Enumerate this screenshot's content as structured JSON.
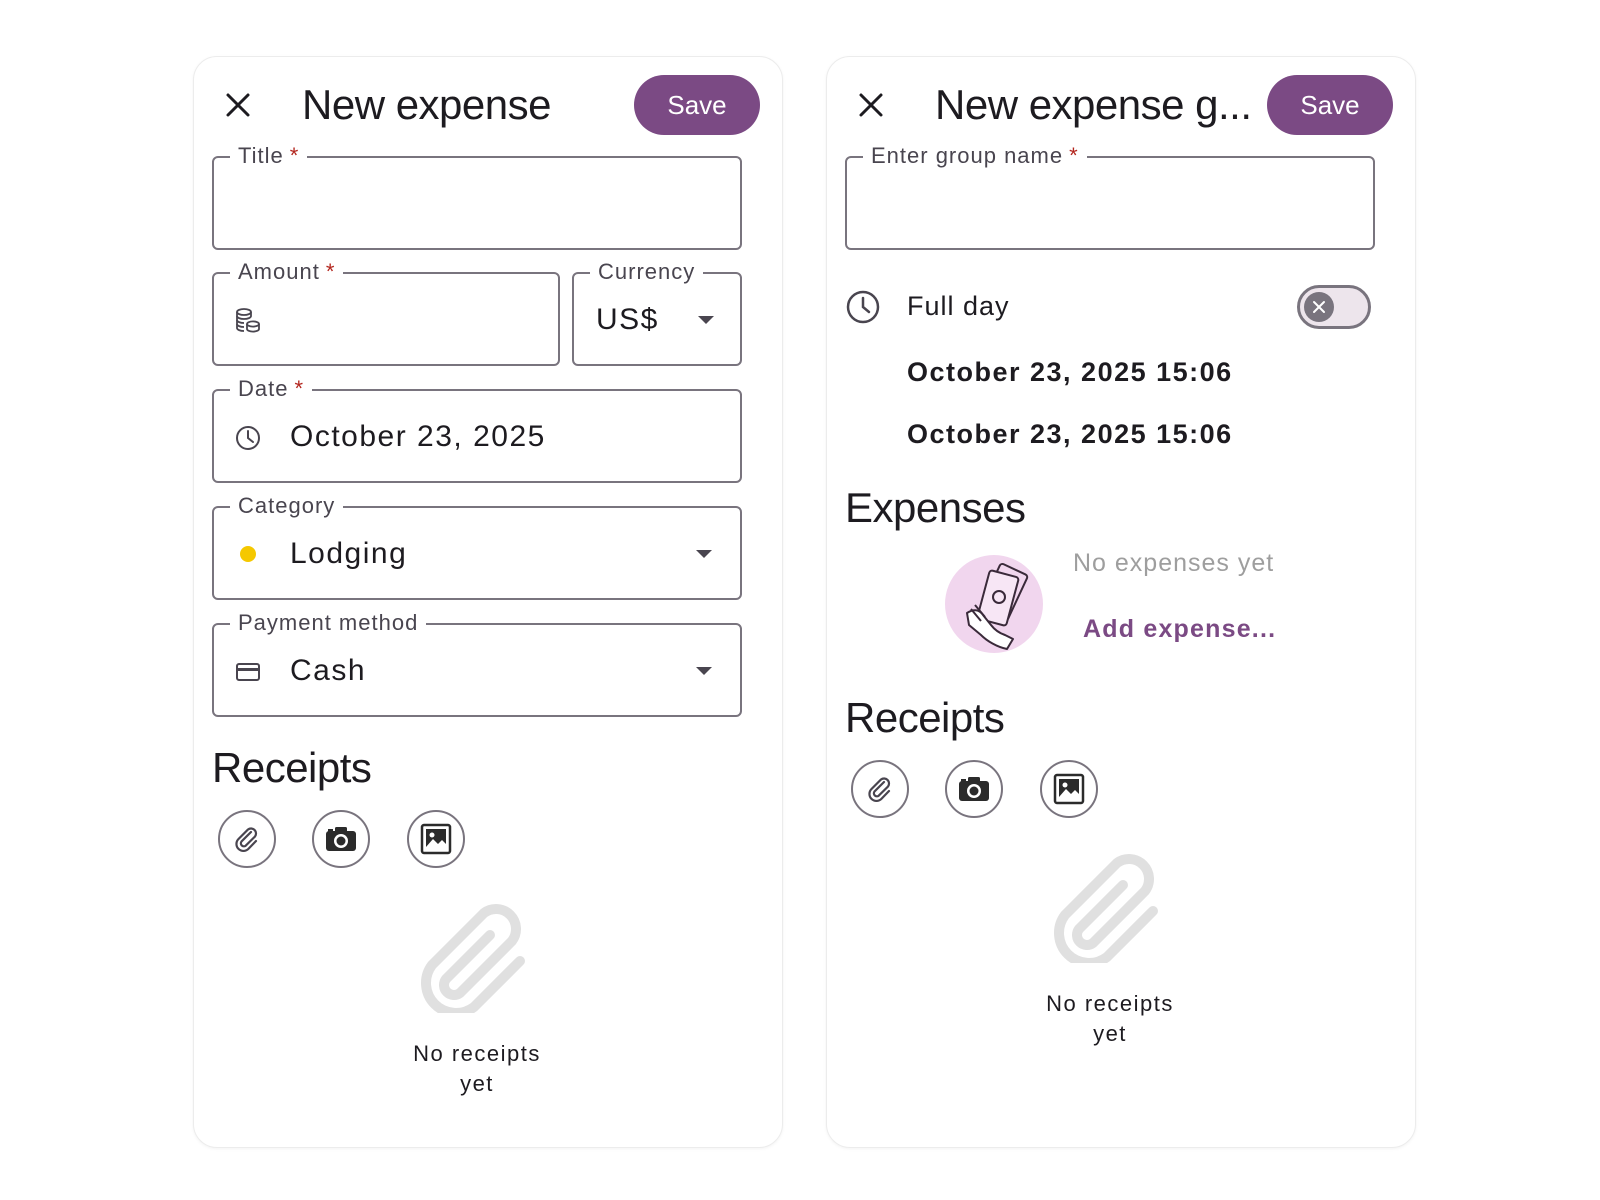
{
  "expense_form": {
    "title": "New expense",
    "save_label": "Save",
    "fields": {
      "title": {
        "label": "Title",
        "value": ""
      },
      "amount": {
        "label": "Amount",
        "value": ""
      },
      "currency": {
        "label": "Currency",
        "value": "US$"
      },
      "date": {
        "label": "Date",
        "value": "October 23, 2025"
      },
      "category": {
        "label": "Category",
        "value": "Lodging",
        "color": "#f5c800"
      },
      "payment": {
        "label": "Payment method",
        "value": "Cash"
      }
    },
    "required_mark": "*",
    "receipts": {
      "heading": "Receipts",
      "empty_line1": "No receipts",
      "empty_line2": "yet"
    }
  },
  "group_form": {
    "title": "New expense g...",
    "save_label": "Save",
    "group_name": {
      "label": "Enter group name",
      "value": ""
    },
    "required_mark": "*",
    "full_day": {
      "label": "Full day",
      "enabled": false
    },
    "start_datetime": "October 23, 2025 15:06",
    "end_datetime": "October 23, 2025 15:06",
    "expenses": {
      "heading": "Expenses",
      "empty_text": "No expenses yet",
      "add_label": "Add expense..."
    },
    "receipts": {
      "heading": "Receipts",
      "empty_line1": "No receipts",
      "empty_line2": "yet"
    }
  },
  "icons": [
    "close-icon",
    "coins-icon",
    "clock-icon",
    "credit-card-icon",
    "dropdown-caret-icon",
    "paperclip-icon",
    "camera-icon",
    "image-icon",
    "hand-holding-money-icon"
  ],
  "colors": {
    "accent": "#7b4a84",
    "outline": "#79747e",
    "required": "#b3261e",
    "empty_text": "#9e9e9e",
    "illustration_bg": "#f1d6ee"
  }
}
